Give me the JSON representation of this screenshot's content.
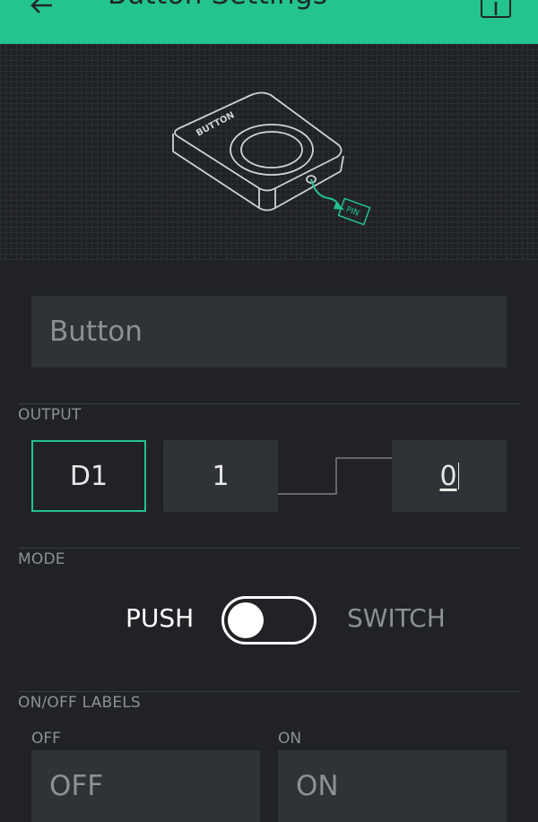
{
  "app_bar": {
    "title": "Button Settings",
    "back_icon": "arrow-left-icon",
    "info_icon": "info-icon",
    "color": "#23c48e"
  },
  "preview": {
    "device_label": "BUTTON",
    "pin_label": "PIN"
  },
  "name_field": {
    "value": "Button"
  },
  "output": {
    "label": "OUTPUT",
    "pin": "D1",
    "high_value": "1",
    "low_value": "0"
  },
  "mode": {
    "label": "MODE",
    "push_label": "PUSH",
    "switch_label": "SWITCH",
    "selected": "PUSH"
  },
  "labels": {
    "label": "ON/OFF LABELS",
    "off_label": "OFF",
    "on_label": "ON",
    "off_value": "OFF",
    "on_value": "ON"
  },
  "colors": {
    "accent": "#23c48e",
    "background": "#202226",
    "field": "#2f3237"
  }
}
